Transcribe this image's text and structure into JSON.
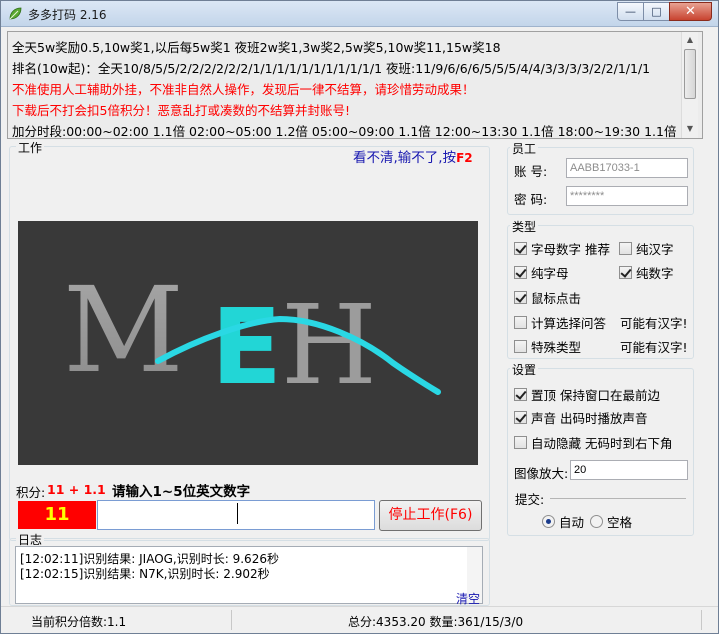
{
  "window": {
    "title": "多多打码 2.16",
    "caption_min": "—",
    "caption_max": "□",
    "caption_close": "✕"
  },
  "notice": {
    "lines": [
      "全天5w奖励0.5,10w奖1,以后每5w奖1 夜班2w奖1,3w奖2,5w奖5,10w奖11,15w奖18",
      "排名(10w起)：全天10/8/5/5/2/2/2/2/2/2/1/1/1/1/1/1/1/1/1/1/1 夜班:11/9/6/6/6/5/5/5/4/4/3/3/3/3/2/2/1/1/1",
      "不准使用人工辅助外挂，不准非自然人操作，发现后一律不结算，请珍惜劳动成果！",
      "下载后不打会扣5倍积分！恶意乱打或凑数的不结算并封账号!",
      "加分时段:00:00~02:00 1.1倍 02:00~05:00 1.2倍 05:00~09:00 1.1倍 12:00~13:30 1.1倍 18:00~19:30 1.1倍"
    ],
    "warning_color": "#ff0000"
  },
  "work": {
    "group_label": "工作",
    "hint_text": "看不清,输不了,按",
    "hint_key": "F2",
    "captcha_text": "MEH",
    "score_label": "积分:",
    "score_value": "11 + 1.1",
    "prompt": "请输入1~5位英文数字",
    "count": "11",
    "answer_value": "",
    "stop_button": "停止工作(F6)"
  },
  "log": {
    "group_label": "日志",
    "entries": [
      "[12:02:11]识别结果: JIAOG,识别时长: 9.626秒",
      "[12:02:15]识别结果: N7K,识别时长: 2.902秒"
    ],
    "clear_link": "清空"
  },
  "staff": {
    "group_label": "员工",
    "account_label": "账  号:",
    "account_value": "AABB17033-1",
    "password_label": "密  码:",
    "password_value": "********"
  },
  "types": {
    "group_label": "类型",
    "items": [
      {
        "label": "字母数字 推荐",
        "checked": true
      },
      {
        "label": "纯汉字",
        "checked": false
      },
      {
        "label": "纯字母",
        "checked": true
      },
      {
        "label": "纯数字",
        "checked": true
      },
      {
        "label": "鼠标点击",
        "checked": true
      },
      {
        "label": "计算选择问答",
        "checked": false
      },
      {
        "label": "特殊类型",
        "checked": false
      }
    ],
    "maybe_chinese_1": "可能有汉字!",
    "maybe_chinese_2": "可能有汉字!"
  },
  "settings": {
    "group_label": "设置",
    "items": [
      {
        "label": "置顶 保持窗口在最前边",
        "checked": true
      },
      {
        "label": "声音 出码时播放声音",
        "checked": true
      },
      {
        "label": "自动隐藏 无码时到右下角",
        "checked": false
      }
    ],
    "zoom_label": "图像放大:",
    "zoom_value": "20",
    "submit_label": "提交:",
    "submit_options": [
      {
        "label": "自动",
        "selected": true
      },
      {
        "label": "空格",
        "selected": false
      }
    ]
  },
  "status": {
    "multiplier": "当前积分倍数:1.1",
    "totals": "总分:4353.20 数量:361/15/3/0"
  }
}
